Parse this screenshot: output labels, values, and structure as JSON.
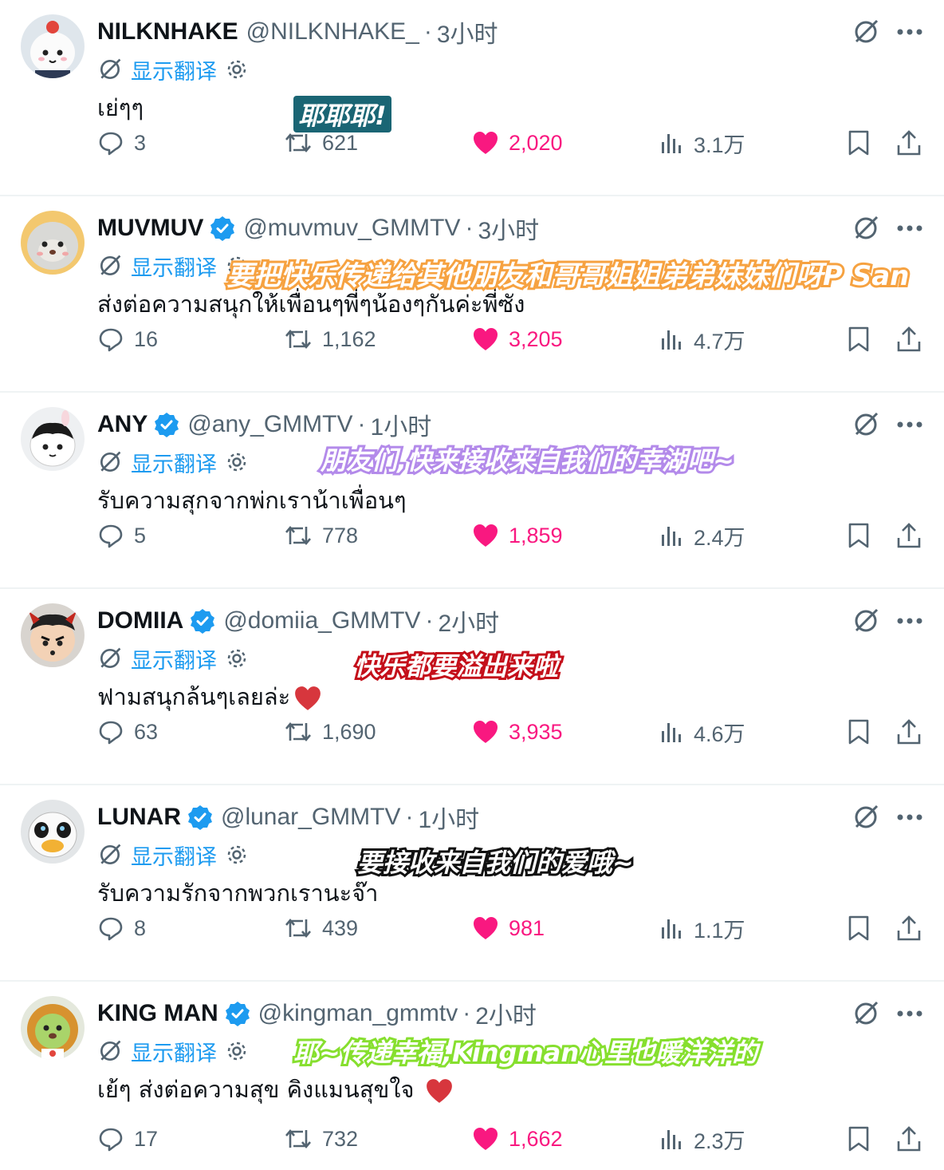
{
  "translate_label": "显示翻译",
  "tweets": [
    {
      "name": "NILKNHAKE",
      "verified": false,
      "handle": "@NILKNHAKE_",
      "dot": "·",
      "time": "3小时",
      "text": "เย่ๆๆ",
      "caption": "耶耶耶!",
      "replies": "3",
      "retweets": "621",
      "likes": "2,020",
      "views": "3.1万",
      "avatar_icon": "white-mascot-avatar"
    },
    {
      "name": "MUVMUV",
      "verified": true,
      "handle": "@muvmuv_GMMTV",
      "dot": "·",
      "time": "3小时",
      "text": "ส่งต่อความสนุกให้เพื่อนๆพี่ๆน้องๆกันค่ะพี่ซัง",
      "caption": "要把快乐传递给其他朋友和哥哥姐姐弟弟妹妹们呀P San",
      "replies": "16",
      "retweets": "1,162",
      "likes": "3,205",
      "views": "4.7万",
      "avatar_icon": "fluffy-mascot-avatar"
    },
    {
      "name": "ANY",
      "verified": true,
      "handle": "@any_GMMTV",
      "dot": "·",
      "time": "1小时",
      "text": "รับความสุกจากพ่กเราน้าเพื่อนๆ",
      "caption": "朋友们,快来接收来自我们的幸湖吧~",
      "replies": "5",
      "retweets": "778",
      "likes": "1,859",
      "views": "2.4万",
      "avatar_icon": "bunny-mascot-avatar"
    },
    {
      "name": "DOMIIA",
      "verified": true,
      "handle": "@domiia_GMMTV",
      "dot": "·",
      "time": "2小时",
      "text": "ฟามสนุกล้นๆเลยล่ะ",
      "caption": "快乐都要溢出来啦",
      "replies": "63",
      "retweets": "1,690",
      "likes": "3,935",
      "views": "4.6万",
      "avatar_icon": "demon-mascot-avatar"
    },
    {
      "name": "LUNAR",
      "verified": true,
      "handle": "@lunar_GMMTV",
      "dot": "·",
      "time": "1小时",
      "text": "รับความรักจากพวกเรานะจ๊า",
      "caption": "要接收来自我们的爱哦~",
      "replies": "8",
      "retweets": "439",
      "likes": "981",
      "views": "1.1万",
      "avatar_icon": "duck-mascot-avatar"
    },
    {
      "name": "KING MAN",
      "verified": true,
      "handle": "@kingman_gmmtv",
      "dot": "·",
      "time": "2小时",
      "text": "เย้ๆ ส่งต่อความสุข คิงแมนสุขใจ",
      "caption": "耶~传递幸福,Kingman心里也暖洋洋的",
      "replies": "17",
      "retweets": "732",
      "likes": "1,662",
      "views": "2.3万",
      "avatar_icon": "lion-mascot-avatar"
    }
  ]
}
